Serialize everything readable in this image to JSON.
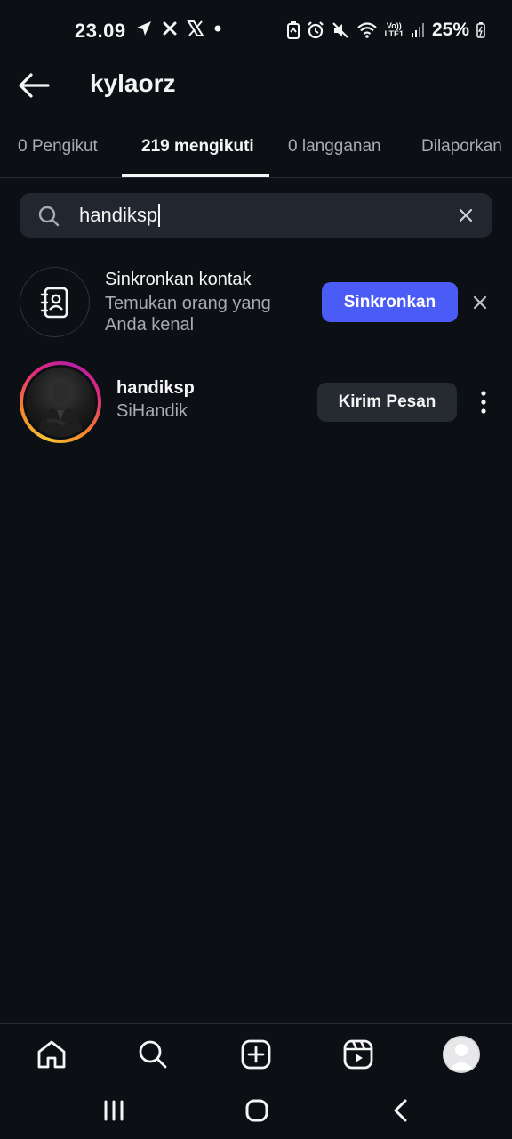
{
  "status_bar": {
    "time": "23.09",
    "battery": "25%",
    "network_top": "Vo))",
    "network_bottom": "LTE1",
    "left_icons": [
      "navigation-arrow-icon",
      "close-x-icon",
      "x-logo-icon",
      "dot-icon"
    ],
    "right_icons": [
      "battery-saver-icon",
      "alarm-icon",
      "mute-icon",
      "wifi-icon",
      "signal-icon",
      "battery-icon"
    ]
  },
  "header": {
    "title": "kylaorz",
    "back_icon": "arrow-left-icon"
  },
  "tabs": [
    {
      "label": "0 Pengikut",
      "active": false
    },
    {
      "label": "219 mengikuti",
      "active": true
    },
    {
      "label": "0 langganan",
      "active": false
    },
    {
      "label": "Dilaporkan",
      "active": false
    }
  ],
  "search": {
    "value": "handiksp",
    "icon": "search-icon",
    "clear_icon": "close-icon"
  },
  "sync_contacts": {
    "title": "Sinkronkan kontak",
    "subtitle": "Temukan orang yang Anda kenal",
    "button_label": "Sinkronkan",
    "icon": "contact-book-icon",
    "button_color": "#4a5cf5"
  },
  "results": [
    {
      "username": "handiksp",
      "full_name": "SiHandik",
      "button_label": "Kirim Pesan",
      "has_story_ring": true
    }
  ],
  "bottom_nav": [
    "home-icon",
    "search-icon",
    "create-icon",
    "reels-icon",
    "profile-avatar"
  ],
  "system_nav": [
    "recents-icon",
    "home-icon",
    "back-icon"
  ],
  "colors": {
    "background": "#0c0f14",
    "surface": "#22262e",
    "accent": "#4a5cf5",
    "text_secondary": "#a8abb1"
  }
}
